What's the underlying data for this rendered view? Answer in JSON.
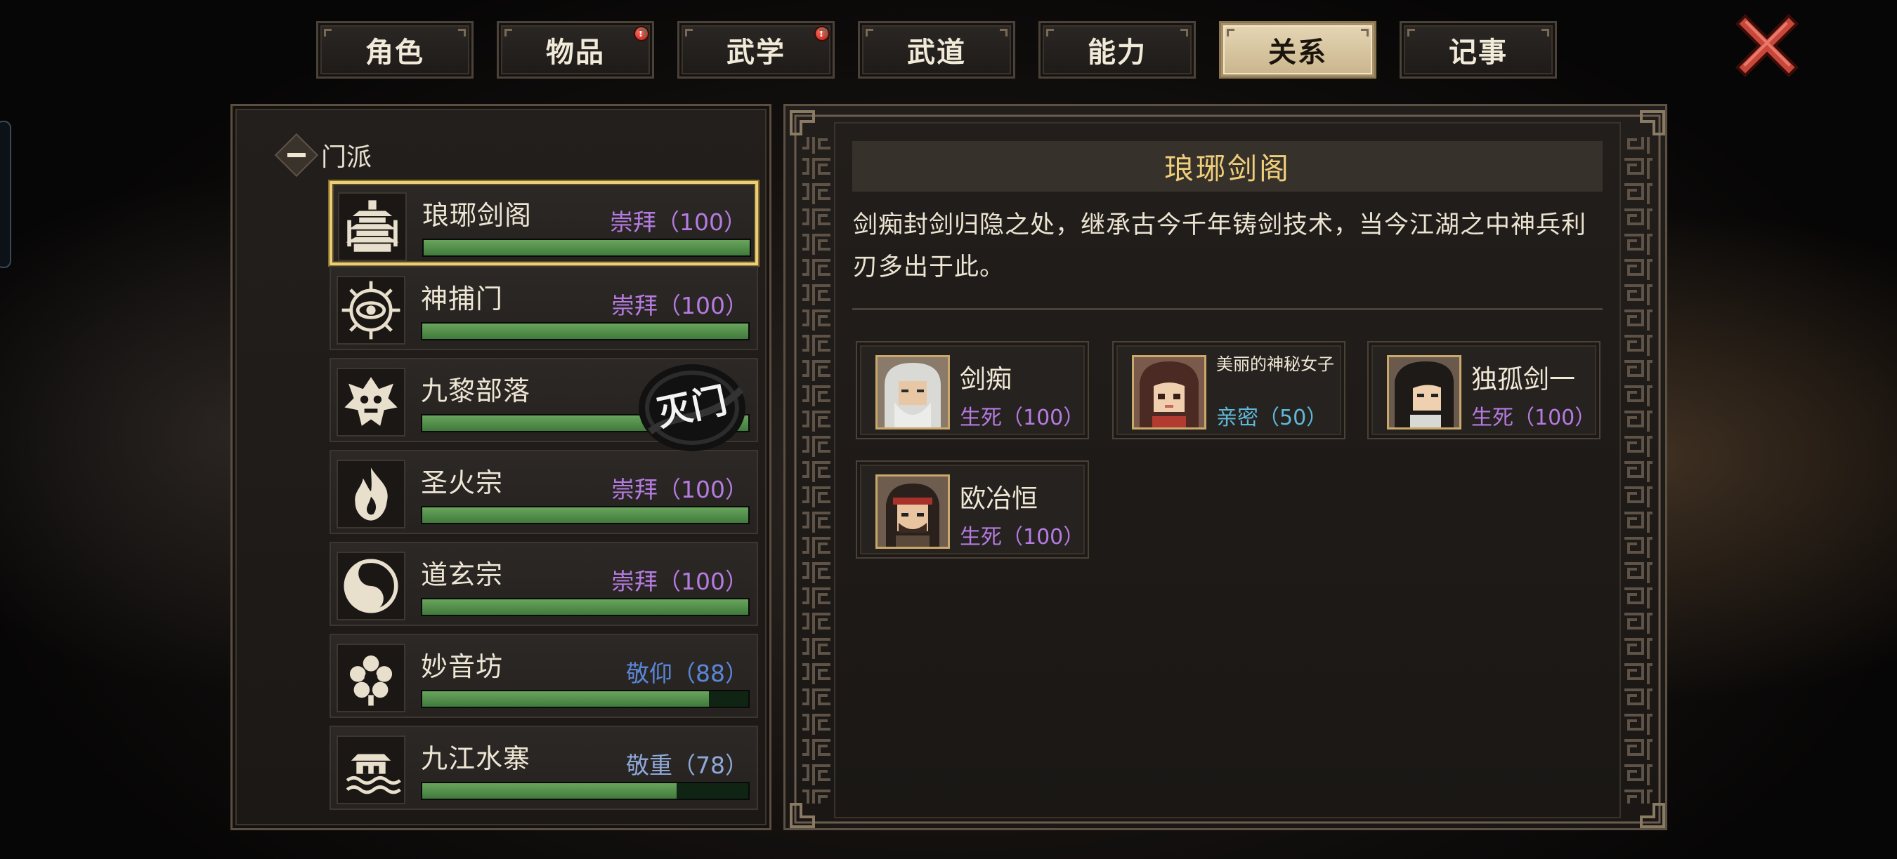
{
  "tabs": [
    {
      "label": "角色",
      "active": false,
      "badge": false
    },
    {
      "label": "物品",
      "active": false,
      "badge": true
    },
    {
      "label": "武学",
      "active": false,
      "badge": true
    },
    {
      "label": "武道",
      "active": false,
      "badge": false
    },
    {
      "label": "能力",
      "active": false,
      "badge": false
    },
    {
      "label": "关系",
      "active": true,
      "badge": false
    },
    {
      "label": "记事",
      "active": false,
      "badge": false
    }
  ],
  "badge_glyph": "!",
  "sect_list": {
    "header": "门派",
    "items": [
      {
        "name": "琅琊剑阁",
        "status": "崇拜（100）",
        "value": 100,
        "max": 100,
        "tier": "worship",
        "emblem": "pagoda-emblem-icon",
        "selected": true
      },
      {
        "name": "神捕门",
        "status": "崇拜（100）",
        "value": 100,
        "max": 100,
        "tier": "worship",
        "emblem": "eye-emblem-icon",
        "selected": false
      },
      {
        "name": "九黎部落",
        "status": "",
        "value": 100,
        "max": 100,
        "tier": "destroyed",
        "emblem": "beast-mask-emblem-icon",
        "selected": false,
        "seal": "灭门"
      },
      {
        "name": "圣火宗",
        "status": "崇拜（100）",
        "value": 100,
        "max": 100,
        "tier": "worship",
        "emblem": "flame-emblem-icon",
        "selected": false
      },
      {
        "name": "道玄宗",
        "status": "崇拜（100）",
        "value": 100,
        "max": 100,
        "tier": "worship",
        "emblem": "yin-yang-crane-emblem-icon",
        "selected": false
      },
      {
        "name": "妙音坊",
        "status": "敬仰（88）",
        "value": 88,
        "max": 100,
        "tier": "respect",
        "emblem": "flower-mask-emblem-icon",
        "selected": false
      },
      {
        "name": "九江水寨",
        "status": "敬重（78）",
        "value": 78,
        "max": 100,
        "tier": "esteem",
        "emblem": "water-fort-emblem-icon",
        "selected": false
      }
    ]
  },
  "detail": {
    "title": "琅琊剑阁",
    "description": "剑痴封剑归隐之处，继承古今千年铸剑技术，当今江湖之中神兵利刃多出于此。",
    "members": [
      {
        "name": "剑痴",
        "relation": "生死（100）",
        "type": "life",
        "portrait": "white-haired-elder-portrait"
      },
      {
        "name": "美丽的神秘女子",
        "relation": "亲密（50）",
        "type": "intimate",
        "portrait": "mysterious-woman-portrait"
      },
      {
        "name": "独孤剑一",
        "relation": "生死（100）",
        "type": "life",
        "portrait": "long-haired-swordsman-portrait"
      },
      {
        "name": "欧冶恒",
        "relation": "生死（100）",
        "type": "life",
        "portrait": "headband-smith-portrait"
      }
    ]
  },
  "colors": {
    "worship": "#b57be0",
    "respect": "#5b86d8",
    "esteem": "#8fa8d8",
    "bar_fill": "#55914c",
    "title_gold": "#f0cf7a",
    "intimate": "#5fb8d8"
  }
}
